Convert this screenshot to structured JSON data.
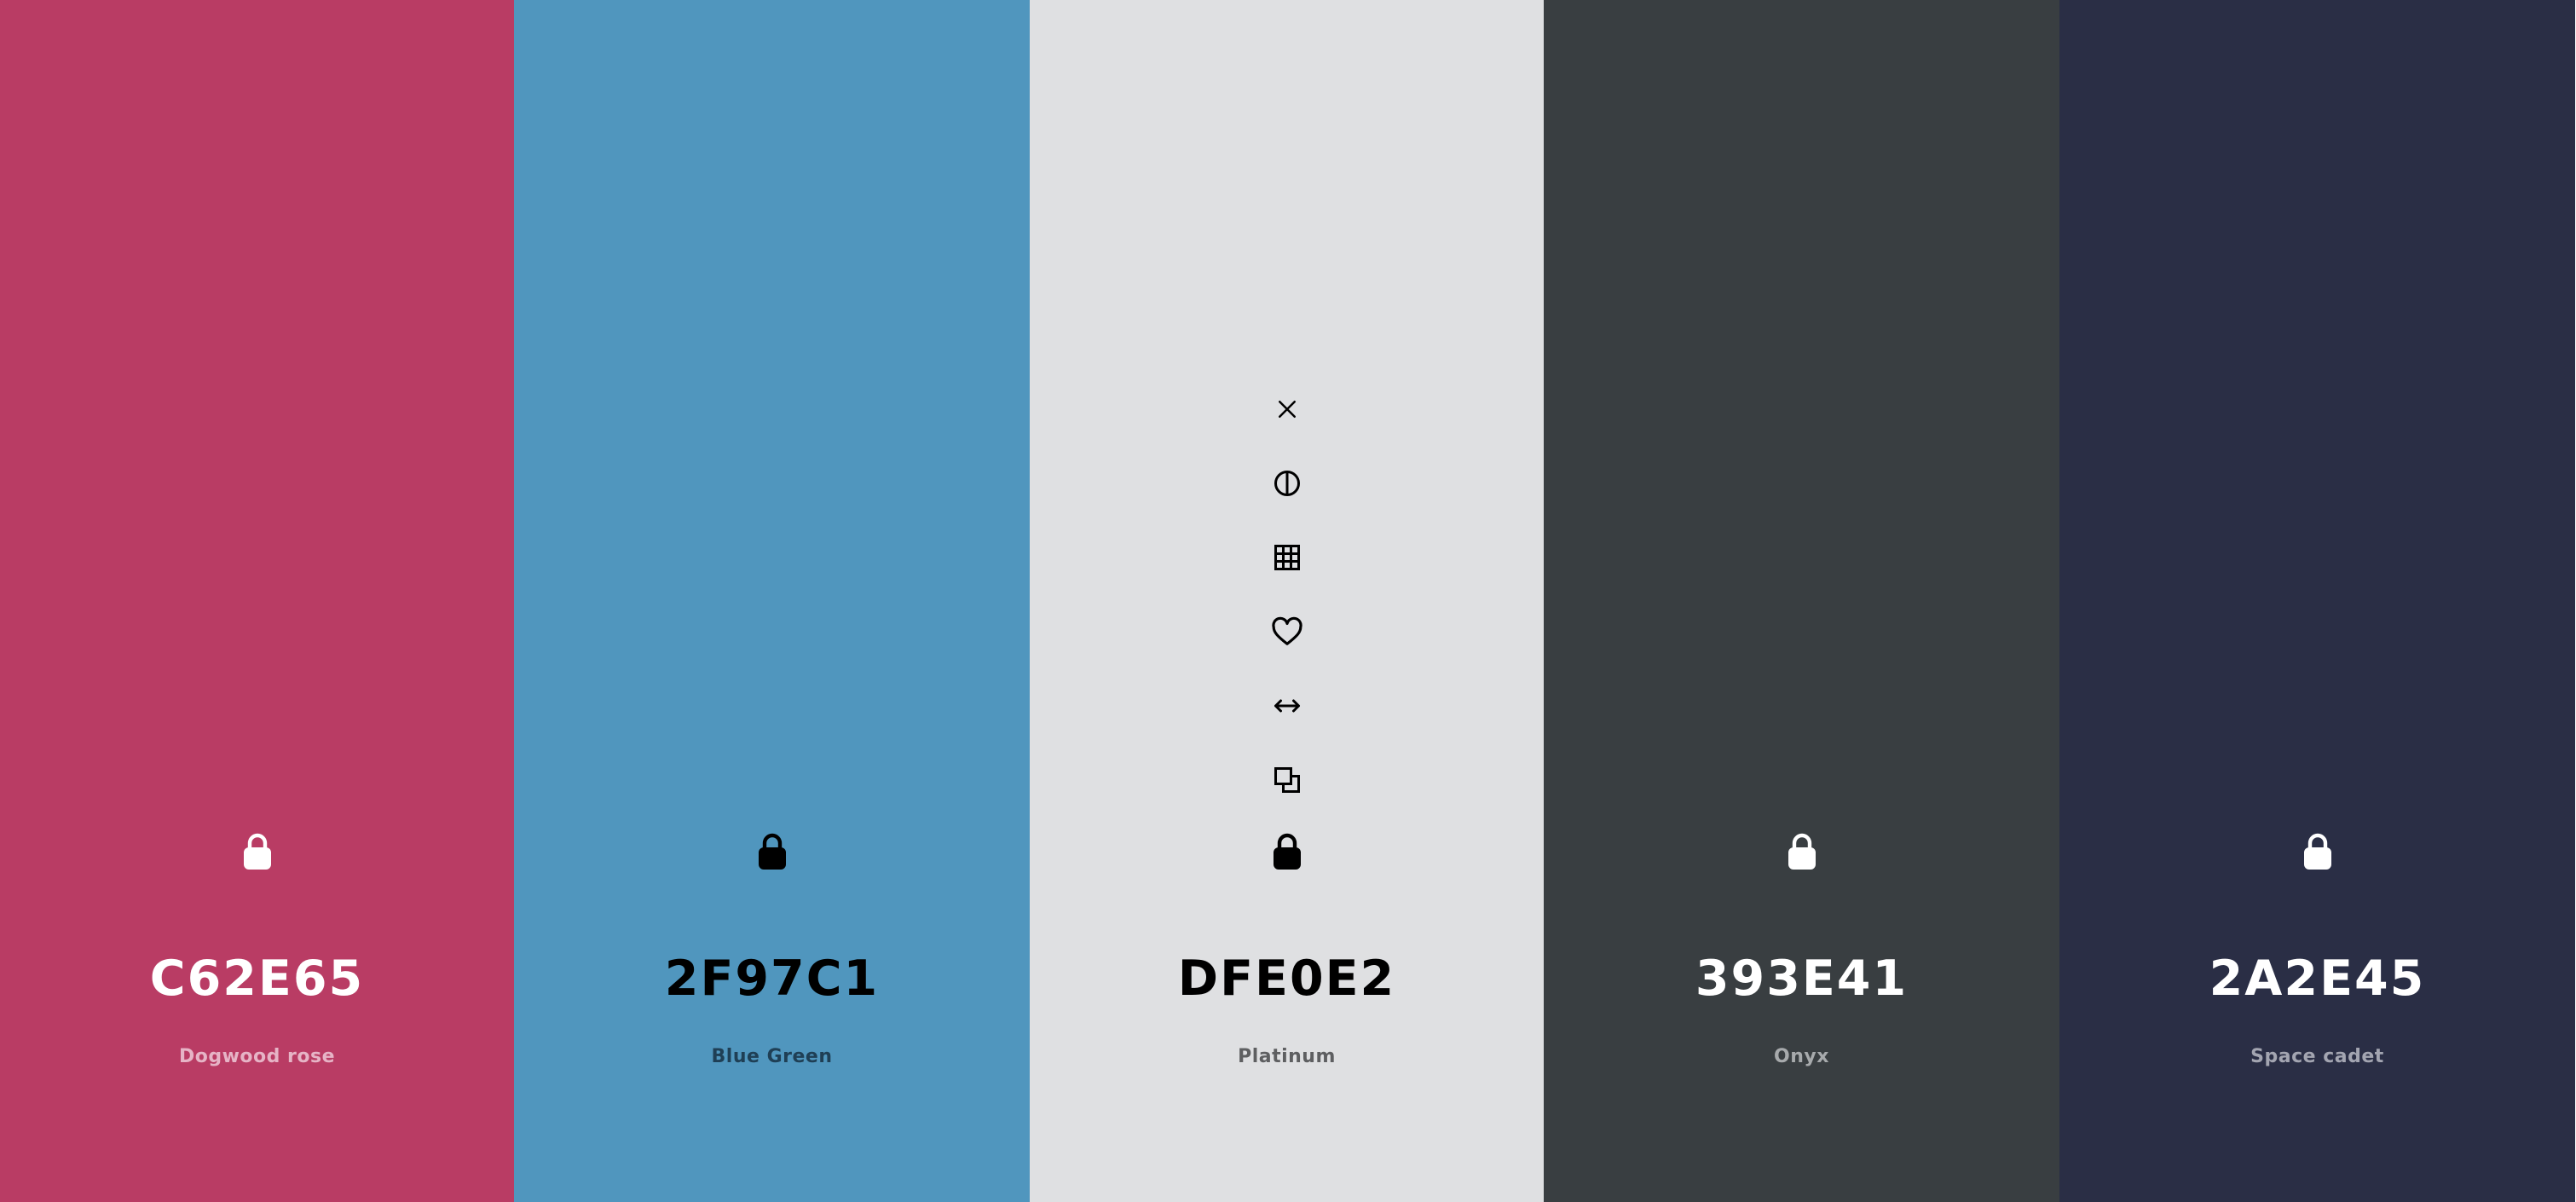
{
  "swatches": [
    {
      "hex": "C62E65",
      "name": "Dogwood rose",
      "background": "#B93C64",
      "text_color": "#FFFFFF",
      "name_color": "#E6B4C6",
      "lock_icon": "lock-icon",
      "lock_color": "#FFFFFF"
    },
    {
      "hex": "2F97C1",
      "name": "Blue Green",
      "background": "#5096BE",
      "text_color": "#000000",
      "name_color": "#1F3F55",
      "lock_icon": "lock-icon",
      "lock_color": "#000000"
    },
    {
      "hex": "DFE0E2",
      "name": "Platinum",
      "background": "#DFE0E2",
      "text_color": "#000000",
      "name_color": "#5E5F61",
      "lock_icon": "lock-icon",
      "lock_color": "#000000",
      "toolbar_icons": [
        "close-icon",
        "contrast-icon",
        "grid-icon",
        "heart-icon",
        "resize-horizontal-icon",
        "copy-icon"
      ]
    },
    {
      "hex": "393E41",
      "name": "Onyx",
      "background": "#393E41",
      "text_color": "#FFFFFF",
      "name_color": "#A7AAAC",
      "lock_icon": "lock-icon",
      "lock_color": "#FFFFFF"
    },
    {
      "hex": "2A2E45",
      "name": "Space cadet",
      "background": "#2A2E45",
      "text_color": "#FFFFFF",
      "name_color": "#A3A5B1",
      "lock_icon": "lock-icon",
      "lock_color": "#FFFFFF"
    }
  ]
}
